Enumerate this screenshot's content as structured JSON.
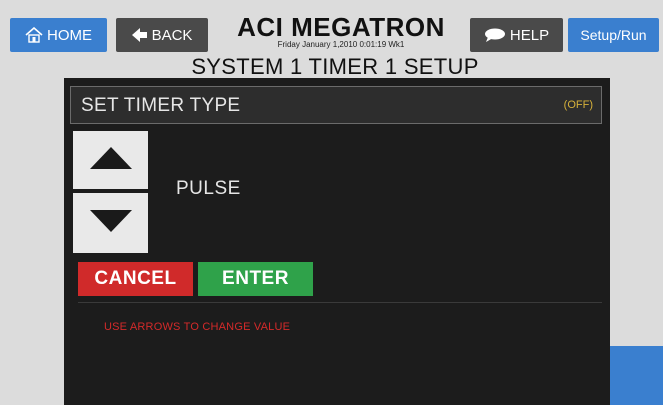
{
  "nav": {
    "home_label": "HOME",
    "back_label": "BACK",
    "help_label": "HELP",
    "setup_label": "Setup/Run"
  },
  "header": {
    "app_title": "ACI MEGATRON",
    "datetime": "Friday January 1,2010 0:01:19 Wk1",
    "page_title": "SYSTEM 1 TIMER 1 SETUP"
  },
  "panel": {
    "type_label": "SET TIMER TYPE",
    "type_status": "(OFF)",
    "current_value": "PULSE",
    "cancel_label": "CANCEL",
    "enter_label": "ENTER",
    "hint": "USE ARROWS TO CHANGE VALUE"
  },
  "icons": {
    "home": "home-icon",
    "back": "back-arrow-icon",
    "help": "speech-bubble-icon",
    "up": "arrow-up-icon",
    "down": "arrow-down-icon"
  },
  "colors": {
    "nav_blue": "#3a7fcf",
    "nav_dark": "#4a4a4a",
    "panel_bg": "#1c1c1c",
    "cancel_red": "#d02a2a",
    "enter_green": "#2fa24a",
    "status_amber": "#d6b13a",
    "hint_red": "#d42a2a"
  }
}
